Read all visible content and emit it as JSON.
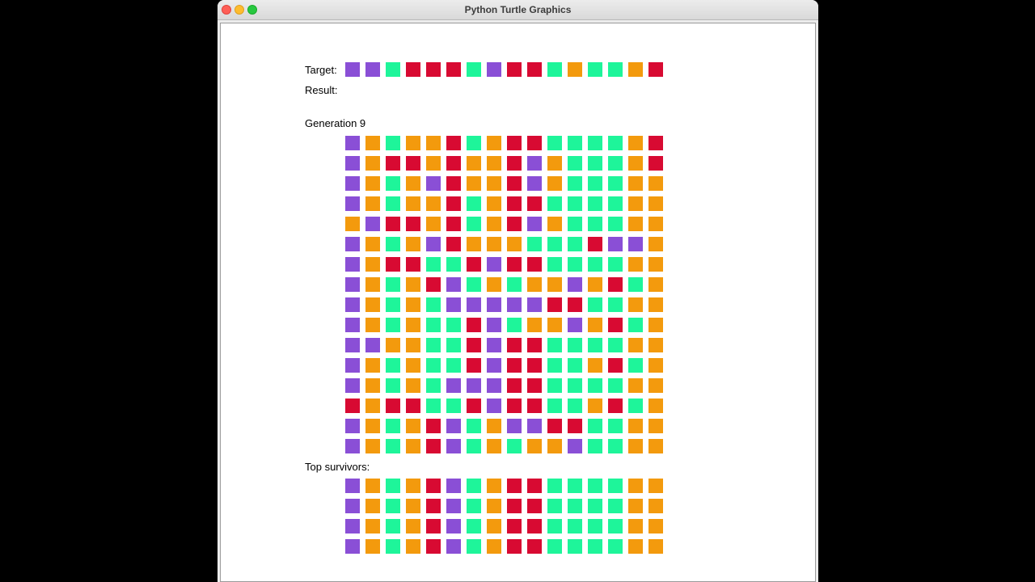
{
  "window": {
    "title": "Python Turtle Graphics"
  },
  "labels": {
    "target": "Target:",
    "result": "Result:",
    "generation": "Generation 9",
    "survivors": "Top survivors:"
  },
  "colors": {
    "P": "#8a4fd6",
    "O": "#f39a0d",
    "G": "#1ef59a",
    "R": "#d80a32"
  },
  "color_names": {
    "P": "purple",
    "O": "orange",
    "G": "green",
    "R": "red"
  },
  "target": "PPGRRRGPRRGOGGOR",
  "population": [
    "POGOORGORRGGGGOR",
    "PORROROORPOGGGOR",
    "POGOPROORPOGGGOO",
    "POGOORGORRGGGGOO",
    "OPRRORGORPOGGGOO",
    "POGOPROOOGGGRPPO",
    "PORRGGRPRRGGGGOO",
    "POGORPGOGOOPORGO",
    "POGOGPPPPPRRGGOO",
    "POGOGGRPGOOPORGO",
    "PPOOGGRPRRGGGGOO",
    "POGOGGRPRRGGORGO",
    "POGOGPPPRRGGGGOO",
    "RORRGGRPRRGGORGO",
    "POGORPGOPPRRGGOO",
    "POGORPGOGOOPGGOO"
  ],
  "survivors": [
    "POGORPGORRGGGGOO",
    "POGORPGORRGGGGOO",
    "POGORPGORRGGGGOO",
    "POGORPGORRGGGGOO"
  ]
}
